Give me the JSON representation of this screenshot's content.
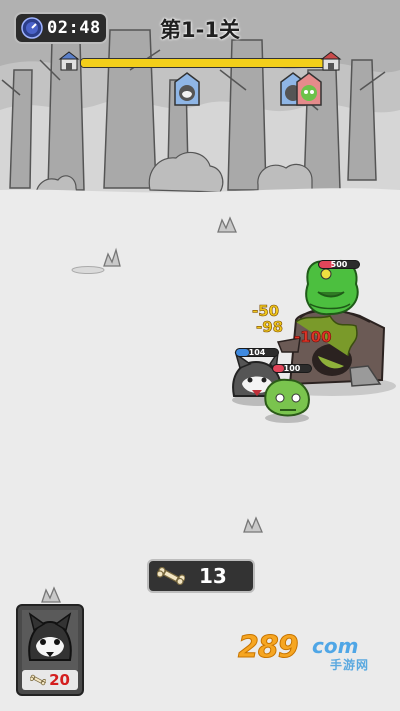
{
  "hud": {
    "timer": "02:48",
    "level_title": "第1-1关",
    "wave_progress": 1.0
  },
  "battle": {
    "damage_numbers": [
      "-50",
      "-98",
      "-100"
    ],
    "boss_hp": "500",
    "husky_hp": "104",
    "zombie_hp": "100"
  },
  "resources": {
    "bone_count": "13"
  },
  "unit_card": {
    "name": "husky",
    "cost": "20"
  },
  "watermark": {
    "number": "289",
    "domain": "com",
    "sub": "手游网"
  },
  "colors": {
    "accent_yellow": "#f3cf1a",
    "hp_red": "#e2455a",
    "hp_blue": "#3f8ae0",
    "cost_red": "#d41e1e"
  },
  "icons": [
    "clock-icon",
    "home-base-icon",
    "enemy-base-icon",
    "husky-marker-icon",
    "zombie-marker-icon",
    "bone-icon"
  ]
}
